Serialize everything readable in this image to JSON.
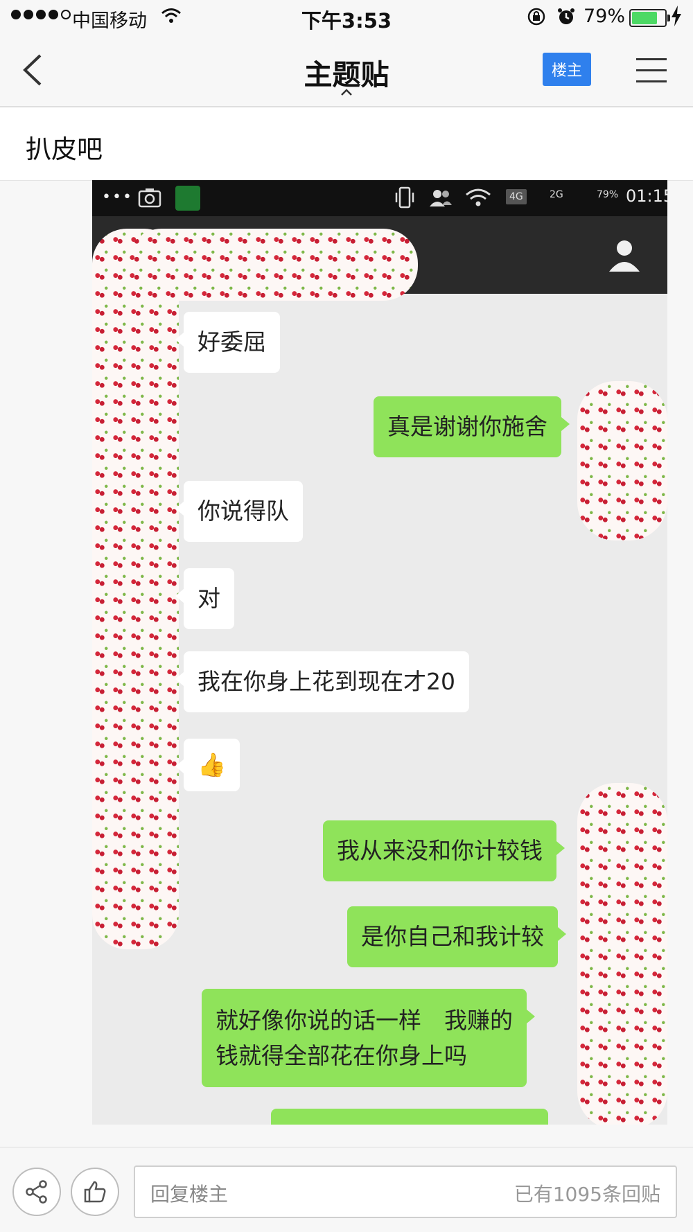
{
  "status_bar": {
    "carrier": "中国移动",
    "time": "下午3:53",
    "battery_pct": "79%",
    "battery_level": 0.79
  },
  "nav": {
    "title": "主题贴",
    "owner_badge": "楼主",
    "icons": [
      "back-chevron-icon",
      "menu-hamburger-icon",
      "caret-up-icon"
    ]
  },
  "forum": {
    "name": "扒皮吧"
  },
  "embedded": {
    "status": {
      "dots": "•••",
      "time": "01:15",
      "net": "4G",
      "net2": "2G",
      "battery": "79%"
    },
    "messages": [
      {
        "side": "in",
        "text": "好委屈"
      },
      {
        "side": "out",
        "text": "真是谢谢你施舍"
      },
      {
        "side": "in",
        "text": "你说得队"
      },
      {
        "side": "in",
        "text": "对"
      },
      {
        "side": "in",
        "text": "我在你身上花到现在才20"
      },
      {
        "side": "in",
        "text": "👍"
      },
      {
        "side": "out",
        "text": "我从来没和你计较钱"
      },
      {
        "side": "out",
        "text": "是你自己和我计较"
      },
      {
        "side": "out",
        "text": "就好像你说的话一样　我赚的\n钱就得全部花在你身上吗"
      }
    ]
  },
  "bottom": {
    "reply_placeholder": "回复楼主",
    "reply_count": "已有1095条回贴",
    "icons": [
      "share-icon",
      "thumbs-up-icon"
    ]
  },
  "colors": {
    "accent": "#2f80ed",
    "bubble_out": "#8fe35a",
    "bubble_in": "#ffffff",
    "battery": "#4cd964"
  }
}
